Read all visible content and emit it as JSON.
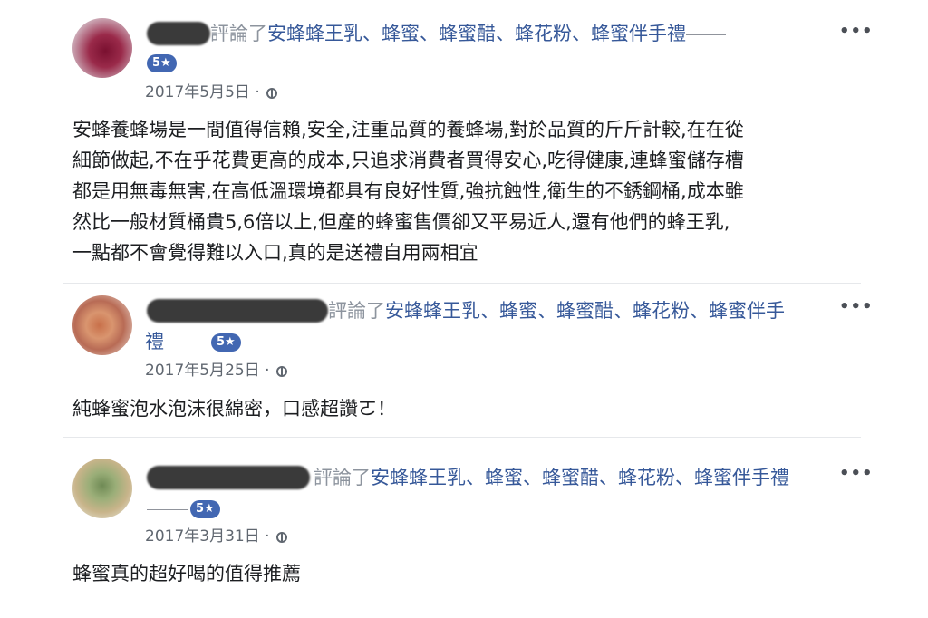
{
  "reviews": [
    {
      "action": "評論了",
      "page_name": "安蜂蜂王乳、蜂蜜、蜂蜜醋、蜂花粉、蜂蜜伴手禮",
      "page_name_line1": "安蜂蜂王乳、蜂蜜、蜂蜜醋、蜂花粉、蜂蜜伴手禮",
      "page_name_line2": "",
      "rating": "5★",
      "date": "2017年5月5日",
      "separator": "·",
      "more": "•••",
      "text_lines": [
        "安蜂養蜂場是一間值得信賴,安全,注重品質的養蜂場,對於品質的斤斤計較,在在從",
        "細節做起,不在乎花費更高的成本,只追求消費者買得安心,吃得健康,連蜂蜜儲存槽",
        "都是用無毒無害,在高低溫環境都具有良好性質,強抗蝕性,衛生的不銹鋼桶,成本雖",
        "然比一般材質桶貴5,6倍以上,但產的蜂蜜售價卻又平易近人,還有他們的蜂王乳,",
        "一點都不會覺得難以入口,真的是送禮自用兩相宜"
      ]
    },
    {
      "action": "評論了",
      "page_name_line1": "安蜂蜂王乳、蜂蜜、蜂蜜醋、蜂花粉、蜂蜜伴手",
      "page_name_line2": "禮",
      "rating": "5★",
      "date": "2017年5月25日",
      "separator": "·",
      "more": "•••",
      "text_lines": [
        "純蜂蜜泡水泡沫很綿密，口感超讚ㄛ！"
      ]
    },
    {
      "action": "評論了",
      "page_name_line1": "安蜂蜂王乳、蜂蜜、蜂蜜醋、蜂花粉、蜂蜜伴手禮",
      "page_name_line2": "",
      "rating": "5★",
      "date": "2017年3月31日",
      "separator": "·",
      "more": "•••",
      "text_lines": [
        "蜂蜜真的超好喝的值得推薦"
      ]
    }
  ]
}
